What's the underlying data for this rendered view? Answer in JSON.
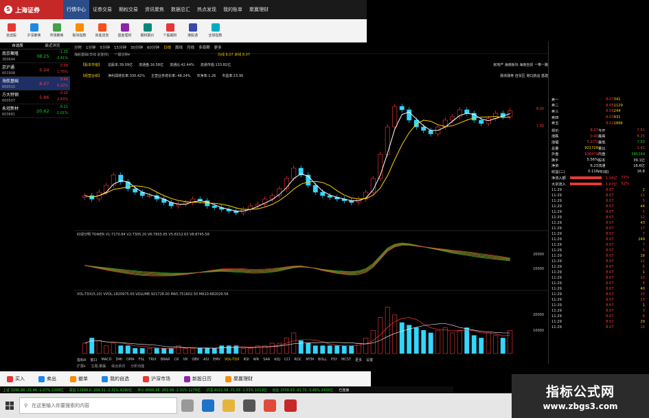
{
  "app": {
    "logo_text": "上海证券",
    "nav": [
      "行情中心",
      "证券交易",
      "期权交易",
      "资讯聚焦",
      "数据总汇",
      "热点发现",
      "我的账单",
      "聚赢理财"
    ],
    "nav_active": 0
  },
  "toolbar": [
    "自选股",
    "沪深聚焦",
    "市场聚焦",
    "板块指数",
    "资金流向",
    "基金理财",
    "期权报价",
    "个股期权",
    "港股通",
    "全球指数"
  ],
  "watchlist": {
    "headers": [
      "自选股",
      "最近浏览"
    ],
    "rows": [
      {
        "name": "南京聚隆",
        "code": "300644",
        "price": "38.25",
        "chg": "-1.35",
        "pct": "-3.41%",
        "color": "green"
      },
      {
        "name": "京沪通",
        "code": "601908",
        "price": "5.24",
        "chg": "0.09",
        "pct": "1.75%",
        "color": "red"
      },
      {
        "name": "海航基础",
        "code": "600515",
        "price": "8.07",
        "chg": "0.40",
        "pct": "5.22%",
        "color": "red",
        "selected": true
      },
      {
        "name": "方大特钢",
        "code": "600507",
        "price": "5.86",
        "chg": "0.15",
        "pct": "2.63%",
        "color": "red"
      },
      {
        "name": "永冠新材",
        "code": "603681",
        "price": "20.62",
        "chg": "-0.21",
        "pct": "-1.01%",
        "color": "green"
      }
    ]
  },
  "chart_head": {
    "periods": [
      "分时",
      "1分钟",
      "5分钟",
      "15分钟",
      "30分钟",
      "60分钟",
      "日线",
      "周线",
      "月线",
      "多周期",
      "更多"
    ],
    "period_active": 6,
    "stock_title": "海航基础(日线 前复权)",
    "stock_sub": "一键切换▾",
    "ma_tag": "均线 8.07 单线 8.07"
  },
  "fund_rows": [
    {
      "tag": "【股本市值】",
      "items": [
        "总股本:39.09亿",
        "流通盘:16.58亿",
        "流通比:42.44%",
        "流通市值:133.82亿"
      ],
      "right": "房地产  海南板块  海南自贸  一带一路"
    },
    {
      "tag": "【经营业绩】",
      "items": [
        "净利润增长率:330.42%",
        "主营业务增长率:-48.24%",
        "市净率:1.26",
        "市盈率:15.95"
      ],
      "right": "融资融券  自贸区  港口航运  基建"
    }
  ],
  "price_axis": [
    "8.00",
    "7.00"
  ],
  "macd_label": "红绿分明  TOWER  V1:7170.84  V2:7305.20  V6:7655.65  V5:8152.63  V8:8745.58",
  "macd_axis": [
    "20000",
    "10000"
  ],
  "vol_label": "VOL-TDX(5,10)  VVOL:1820975.00  VOLUME:921728.00  MA5:751602.50  MA10:682029.56",
  "vol_axis": [
    "20000",
    "10000"
  ],
  "indicator_tabs": [
    "指标A",
    "窗口",
    "MACD",
    "DMI",
    "DMA",
    "FSL",
    "TRIX",
    "BRAR",
    "CR",
    "VR",
    "OBV",
    "ASI",
    "EMV",
    "VOL-TDX",
    "RSI",
    "WR",
    "SAR",
    "KDJ",
    "CCI",
    "ROC",
    "MTM",
    "BOLL",
    "PSY",
    "MCST",
    "更多",
    "设置"
  ],
  "indicator_sub": [
    "扩展▾",
    "主题:聚赢",
    "综合资讯",
    "分析功能"
  ],
  "quote": {
    "levels": [
      [
        "卖一",
        "8.07",
        "341"
      ],
      [
        "卖二",
        "8.05",
        "1129"
      ],
      [
        "卖三",
        "8.04",
        "244"
      ],
      [
        "卖四",
        "8.03",
        "931"
      ],
      [
        "卖五",
        "8.02",
        "1896"
      ]
    ],
    "stats": [
      [
        "现价",
        "8.07",
        "今开",
        "7.51"
      ],
      [
        "涨跌",
        "0.40",
        "最高",
        "8.25"
      ],
      [
        "涨幅",
        "5.22%",
        "最低",
        "7.50"
      ],
      [
        "总量",
        "921728",
        "量比",
        "1.41"
      ],
      [
        "外盘",
        "536479",
        "内盘",
        "385249"
      ],
      [
        "换手",
        "5.56%",
        "股本",
        "39.1亿"
      ],
      [
        "净资",
        "6.23",
        "流通",
        "16.6亿"
      ],
      [
        "收益(二)",
        "0.116",
        "PE(动)",
        "16.8"
      ]
    ],
    "flows": [
      [
        "净流入额",
        "1.16亿",
        "71%"
      ],
      [
        "大宗流入",
        "1.07亿",
        "52%"
      ]
    ],
    "ticks": [
      [
        "11:29",
        "8.07",
        "2"
      ],
      [
        "11:29",
        "8.07",
        "22"
      ],
      [
        "11:29",
        "8.07",
        "5"
      ],
      [
        "11:29",
        "8.07",
        "44"
      ],
      [
        "11:29",
        "8.07",
        "5"
      ],
      [
        "11:29",
        "8.07",
        "12"
      ],
      [
        "11:29",
        "8.07",
        "43"
      ],
      [
        "11:29",
        "8.07",
        "17"
      ],
      [
        "11:29",
        "8.07",
        "7"
      ],
      [
        "11:29",
        "8.07",
        "249"
      ],
      [
        "11:29",
        "8.07",
        "7"
      ],
      [
        "11:29",
        "8.07",
        "5"
      ],
      [
        "11:29",
        "8.07",
        "18"
      ],
      [
        "11:29",
        "8.07",
        "22"
      ],
      [
        "11:29",
        "8.07",
        "6"
      ],
      [
        "11:29",
        "8.07",
        "1"
      ],
      [
        "11:29",
        "8.07",
        "10"
      ],
      [
        "11:29",
        "8.07",
        "8"
      ],
      [
        "11:29",
        "8.07",
        "40"
      ],
      [
        "11:29",
        "8.07",
        "15"
      ],
      [
        "11:29",
        "8.07",
        "23"
      ],
      [
        "11:29",
        "8.07",
        "1"
      ],
      [
        "11:29",
        "8.07",
        "3"
      ],
      [
        "11:29",
        "8.07",
        "6"
      ],
      [
        "11:29",
        "8.07",
        "29"
      ],
      [
        "11:29",
        "8.07",
        "16"
      ]
    ]
  },
  "actions": [
    "买入",
    "卖出",
    "撤单",
    "我的自选",
    "沪深市场",
    "新股日历",
    "聚赢理财"
  ],
  "ticker": [
    "上证 3290.98 -35.46 -1.07% 2209亿",
    "深证 12999.0 -204.31 -2.31% 4290亿",
    "中小 8566.98 -202.06 -2.31% 1279亿",
    "沪深 4022.58 -71.03 -1.53% 1013亿",
    "创业 2558.93 -91.70 -3.46% 2409亿",
    "已连接"
  ],
  "taskbar": {
    "search_placeholder": "在这里输入你要搜索的内容"
  },
  "watermark": {
    "title": "指标公式网",
    "url": "www.zbgs3.com"
  },
  "colors": {
    "up": "#ff3b3b",
    "down": "#16d916",
    "accent": "#ffd400",
    "bar_cyan": "#33d6ff",
    "brand": "#c62828"
  },
  "chart_data": {
    "type": "candlestick",
    "symbol": "海航基础 600515",
    "y_ticks": [
      "8.00",
      "7.00"
    ],
    "close_series": [
      5.6,
      5.5,
      5.7,
      5.9,
      6.2,
      6.0,
      5.8,
      5.7,
      5.6,
      5.6,
      5.5,
      5.4,
      5.3,
      5.35,
      5.4,
      5.5,
      5.45,
      5.3,
      5.25,
      5.2,
      5.15,
      5.1,
      5.2,
      5.3,
      5.35,
      5.5,
      5.6,
      5.8,
      6.1,
      6.4,
      6.2,
      5.9,
      5.7,
      5.6,
      5.55,
      5.5,
      5.45,
      5.4,
      5.5,
      5.7,
      6.1,
      6.8,
      7.6,
      8.2,
      8.1,
      7.8,
      7.6,
      7.5,
      7.4,
      7.6,
      7.8,
      7.9,
      8.1,
      8.0,
      7.8,
      7.7,
      7.85,
      8.0,
      7.9,
      8.07
    ],
    "volume_series": [
      4,
      6,
      5,
      3,
      4,
      3,
      3,
      2,
      2,
      2,
      2,
      2,
      2,
      3,
      2,
      2,
      2,
      2,
      2,
      3,
      3,
      3,
      2,
      2,
      3,
      3,
      4,
      4,
      6,
      8,
      5,
      4,
      3,
      3,
      3,
      3,
      3,
      3,
      4,
      6,
      9,
      14,
      18,
      15,
      12,
      11,
      10,
      9,
      8,
      9,
      10,
      8,
      9,
      10,
      7,
      6,
      8,
      7,
      6,
      9
    ],
    "macd_series": [
      0.5,
      0.48,
      0.46,
      0.44,
      0.42,
      0.4,
      0.38,
      0.36,
      0.34,
      0.33,
      0.32,
      0.31,
      0.3,
      0.3,
      0.3,
      0.31,
      0.32,
      0.33,
      0.34,
      0.35,
      0.34,
      0.33,
      0.32,
      0.3,
      0.3,
      0.31,
      0.33,
      0.36,
      0.4,
      0.44,
      0.46,
      0.45,
      0.43,
      0.4,
      0.38,
      0.36,
      0.35,
      0.34,
      0.36,
      0.42,
      0.55,
      0.75,
      0.95,
      1.05,
      1.08,
      1.06,
      1.02,
      0.98,
      0.94,
      0.9,
      0.86,
      0.82,
      0.79,
      0.76,
      0.73,
      0.7,
      0.68,
      0.66,
      0.64,
      0.62
    ]
  }
}
